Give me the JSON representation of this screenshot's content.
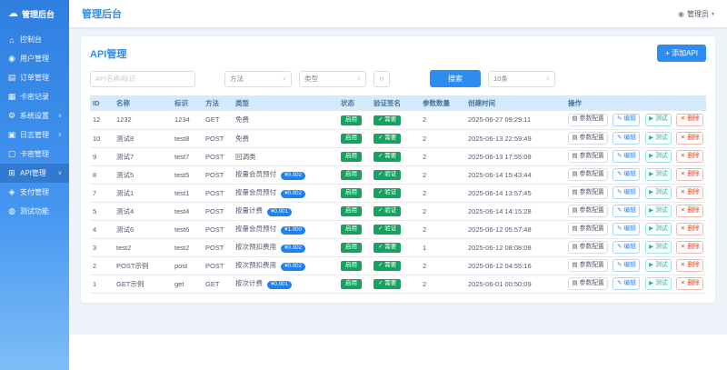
{
  "app": {
    "logo_icon": "cloud-icon",
    "logo_glyph": "☁",
    "title": "管理后台"
  },
  "header": {
    "title": "管理后台",
    "user": {
      "icon": "user-icon",
      "glyph": "◉",
      "name": "管理员",
      "caret": "▾"
    }
  },
  "sidebar": {
    "items": [
      {
        "key": "console",
        "label": "控制台",
        "icon": "dashboard-icon",
        "glyph": "⌂",
        "expandable": false,
        "active": false
      },
      {
        "key": "users",
        "label": "用户管理",
        "icon": "users-icon",
        "glyph": "◉",
        "expandable": false,
        "active": false
      },
      {
        "key": "orders",
        "label": "订单管理",
        "icon": "orders-icon",
        "glyph": "▤",
        "expandable": false,
        "active": false
      },
      {
        "key": "records",
        "label": "卡密记录",
        "icon": "records-icon",
        "glyph": "▦",
        "expandable": false,
        "active": false
      },
      {
        "key": "settings",
        "label": "系统设置",
        "icon": "gear-icon",
        "glyph": "⚙",
        "expandable": true,
        "active": false
      },
      {
        "key": "logs",
        "label": "日志管理",
        "icon": "logs-icon",
        "glyph": "▣",
        "expandable": true,
        "active": false
      },
      {
        "key": "cards",
        "label": "卡密管理",
        "icon": "card-icon",
        "glyph": "▢",
        "expandable": false,
        "active": false
      },
      {
        "key": "api",
        "label": "API管理",
        "icon": "api-icon",
        "glyph": "⊞",
        "expandable": true,
        "active": true
      },
      {
        "key": "payment",
        "label": "支付管理",
        "icon": "payment-icon",
        "glyph": "◈",
        "expandable": false,
        "active": false
      },
      {
        "key": "test",
        "label": "测试功能",
        "icon": "flask-icon",
        "glyph": "◍",
        "expandable": false,
        "active": false
      }
    ],
    "chevron_glyph": "∨"
  },
  "page": {
    "title": "API管理",
    "add_button": "+ 添加API"
  },
  "filters": {
    "search_placeholder": "API名称/标识",
    "method_select": "方法",
    "type_select": "类型",
    "reset_icon": "refresh-icon",
    "reset_glyph": "○",
    "search_button": "搜索",
    "page_size": "10条",
    "caret": "∨"
  },
  "table": {
    "headers": [
      "ID",
      "名称",
      "标识",
      "方法",
      "类型",
      "状态",
      "验证签名",
      "参数数量",
      "创建时间",
      "操作"
    ],
    "actions": [
      {
        "key": "params",
        "icon": "list-icon",
        "glyph": "▤",
        "label": "参数配置"
      },
      {
        "key": "edit",
        "icon": "pencil-icon",
        "glyph": "✎",
        "label": "编辑"
      },
      {
        "key": "test",
        "icon": "play-icon",
        "glyph": "▶",
        "label": "测试"
      },
      {
        "key": "delete",
        "icon": "trash-icon",
        "glyph": "✕",
        "label": "删除"
      }
    ],
    "rows": [
      {
        "id": "12",
        "name": "1232",
        "key": "1234",
        "method": "GET",
        "type": "免费",
        "price": "",
        "status": "启用",
        "sign": "✓ 需要",
        "params": "2",
        "created": "2025-06-27 09:29:11"
      },
      {
        "id": "10",
        "name": "测试8",
        "key": "test8",
        "method": "POST",
        "type": "免费",
        "price": "",
        "status": "启用",
        "sign": "✓ 需要",
        "params": "2",
        "created": "2025-06-13 22:59:49"
      },
      {
        "id": "9",
        "name": "测试7",
        "key": "test7",
        "method": "POST",
        "type": "回调类",
        "price": "",
        "status": "启用",
        "sign": "✓ 需要",
        "params": "2",
        "created": "2025-06-13 17:55:08"
      },
      {
        "id": "8",
        "name": "测试5",
        "key": "test5",
        "method": "POST",
        "type": "按量会员预付",
        "price": "¥0.002",
        "status": "启用",
        "sign": "✓ 验证",
        "params": "2",
        "created": "2025-06-14 15:43:44"
      },
      {
        "id": "7",
        "name": "测试1",
        "key": "test1",
        "method": "POST",
        "type": "按量会员预付",
        "price": "¥0.002",
        "status": "启用",
        "sign": "✓ 验证",
        "params": "2",
        "created": "2025-06-14 13:57:45"
      },
      {
        "id": "5",
        "name": "测试4",
        "key": "test4",
        "method": "POST",
        "type": "按量计费",
        "price": "¥0.001",
        "status": "启用",
        "sign": "✓ 验证",
        "params": "2",
        "created": "2025-06-14 14:15:28"
      },
      {
        "id": "4",
        "name": "测试6",
        "key": "test6",
        "method": "POST",
        "type": "按量会员预付",
        "price": "¥1.000",
        "status": "启用",
        "sign": "✓ 验证",
        "params": "2",
        "created": "2025-06-12 05:57:48"
      },
      {
        "id": "3",
        "name": "test2",
        "key": "test2",
        "method": "POST",
        "type": "按次预扣费用",
        "price": "¥0.002",
        "status": "启用",
        "sign": "✓ 需要",
        "params": "1",
        "created": "2025-06-12 08:08:08"
      },
      {
        "id": "2",
        "name": "POST示例",
        "key": "post",
        "method": "POST",
        "type": "按次预扣费用",
        "price": "¥0.002",
        "status": "启用",
        "sign": "✓ 需要",
        "params": "2",
        "created": "2025-06-12 04:55:16"
      },
      {
        "id": "1",
        "name": "GET示例",
        "key": "get",
        "method": "GET",
        "type": "按次计费",
        "price": "¥0.001",
        "status": "启用",
        "sign": "✓ 需要",
        "params": "2",
        "created": "2025-06-01 00:50:09"
      }
    ]
  },
  "colors": {
    "accent": "#2d8cf0",
    "sidebar_top": "#2e7fe0",
    "sidebar_bottom": "#7dbdf8",
    "badge_green": "#19a15f",
    "price_blue": "#2080f0",
    "edit_blue": "#2d8cf0",
    "test_teal": "#1cb5a3",
    "delete_red": "#ed4014",
    "table_header_bg": "#d7eafc"
  }
}
